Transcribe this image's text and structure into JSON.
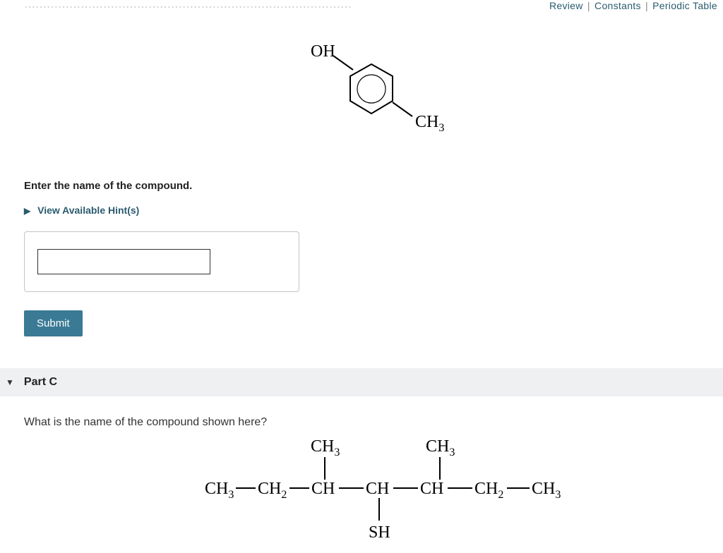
{
  "top_links": {
    "review": "Review",
    "constants": "Constants",
    "periodic": "Periodic Table"
  },
  "partB": {
    "partial_question": "What is the name of the compound shown here?",
    "structure": {
      "oh": "OH",
      "ch3": "CH",
      "ch3_sub": "3"
    },
    "prompt": "Enter the name of the compound.",
    "hints_label": "View Available Hint(s)",
    "answer_value": "",
    "submit_label": "Submit"
  },
  "partC": {
    "header": "Part C",
    "question": "What is the name of the compound shown here?",
    "structure": {
      "ch3": "CH",
      "sub3": "3",
      "ch2": "CH",
      "sub2": "2",
      "ch": "CH",
      "sh": "SH"
    }
  }
}
